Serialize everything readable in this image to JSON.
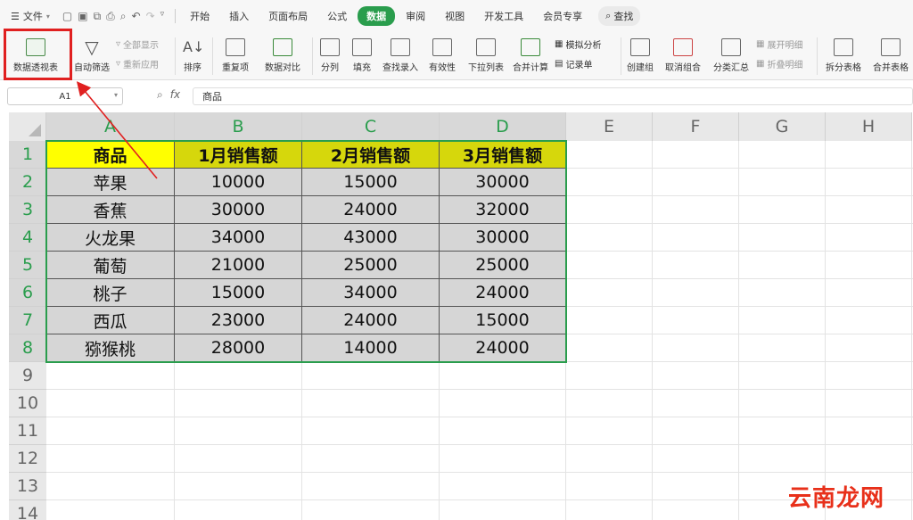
{
  "menubar": {
    "file_label": "文件",
    "tabs": [
      {
        "label": "开始",
        "active": false
      },
      {
        "label": "插入",
        "active": false
      },
      {
        "label": "页面布局",
        "active": false
      },
      {
        "label": "公式",
        "active": false
      },
      {
        "label": "数据",
        "active": true
      },
      {
        "label": "审阅",
        "active": false
      },
      {
        "label": "视图",
        "active": false
      },
      {
        "label": "开发工具",
        "active": false
      },
      {
        "label": "会员专享",
        "active": false
      }
    ],
    "search_label": "查找",
    "accent_color": "#2a9d4d"
  },
  "ribbon": {
    "pivot_table": "数据透视表",
    "auto_filter": "自动筛选",
    "show_all": "全部显示",
    "reapply": "重新应用",
    "sort": "排序",
    "duplicates": "重复项",
    "data_compare": "数据对比",
    "split_column": "分列",
    "fill": "填充",
    "lookup_entry": "查找录入",
    "validity": "有效性",
    "dropdown_list": "下拉列表",
    "consolidate": "合并计算",
    "simulation": "模拟分析",
    "record_form": "记录单",
    "create_group": "创建组",
    "ungroup": "取消组合",
    "subtotal": "分类汇总",
    "expand_detail": "展开明细",
    "collapse_detail": "折叠明细",
    "split_table": "拆分表格",
    "merge_table": "合并表格"
  },
  "formula_bar": {
    "cell_ref": "A1",
    "fx_label": "fx",
    "value": "商品"
  },
  "sheet": {
    "columns": [
      "A",
      "B",
      "C",
      "D",
      "E",
      "F",
      "G",
      "H"
    ],
    "rows": [
      "1",
      "2",
      "3",
      "4",
      "5",
      "6",
      "7",
      "8",
      "9",
      "10",
      "11",
      "12",
      "13",
      "14"
    ],
    "header": [
      "商品",
      "1月销售额",
      "2月销售额",
      "3月销售额"
    ],
    "data": [
      [
        "苹果",
        "10000",
        "15000",
        "30000"
      ],
      [
        "香蕉",
        "30000",
        "24000",
        "32000"
      ],
      [
        "火龙果",
        "34000",
        "43000",
        "30000"
      ],
      [
        "葡萄",
        "21000",
        "25000",
        "25000"
      ],
      [
        "桃子",
        "15000",
        "34000",
        "24000"
      ],
      [
        "西瓜",
        "23000",
        "24000",
        "15000"
      ],
      [
        "猕猴桃",
        "28000",
        "14000",
        "24000"
      ]
    ]
  },
  "watermark": "云南龙网"
}
